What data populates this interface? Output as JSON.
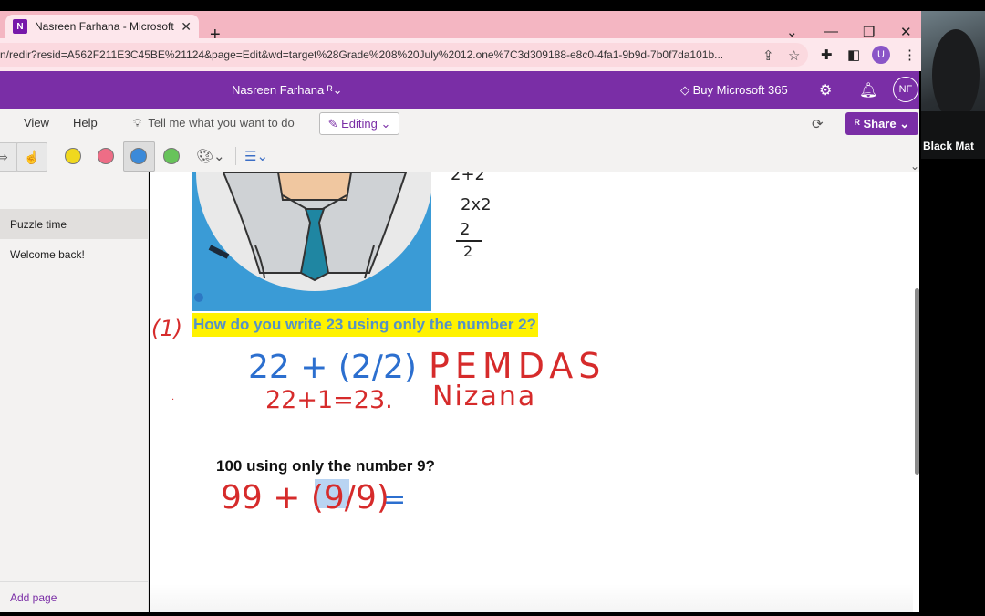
{
  "browser": {
    "tab_title": "Nasreen Farhana - Microsoft One",
    "tab_logo": "N",
    "url": "n/redir?resid=A562F211E3C45BE%21124&page=Edit&wd=target%28Grade%208%20July%2012.one%7C3d309188-e8c0-4fa1-9b9d-7b0f7da101b...",
    "profile_letter": "U"
  },
  "app_header": {
    "user_name": "Nasreen Farhana",
    "buy_label": "Buy Microsoft 365",
    "avatar_initials": "NF"
  },
  "ribbon": {
    "menu_view": "View",
    "menu_help": "Help",
    "tell_me": "Tell me what you want to do",
    "editing_label": "Editing",
    "share_label": "Share"
  },
  "toolbar": {
    "colors": [
      "#f0d81e",
      "#ee6d86",
      "#3b8ad9",
      "#67c35a"
    ]
  },
  "sidebar": {
    "pages": [
      "Puzzle time",
      "Welcome back!"
    ],
    "add_page": "Add page"
  },
  "note": {
    "question1": "How do you write 23 using only the number 2?",
    "question2": "100 using only the number 9?",
    "ink_side": [
      "2+2",
      "2x2",
      "2",
      "2"
    ],
    "ink_q1_label": "(1)",
    "ink_eq1": "22 + (2/2)",
    "ink_eq1_result": "22+1=23.",
    "ink_pemdas": "PEMDAS",
    "ink_name": "Nizana",
    "ink_eq2": "99 + (9/9)",
    "ink_eq2_equals": "="
  },
  "webcam": {
    "label": "Black Mat"
  }
}
